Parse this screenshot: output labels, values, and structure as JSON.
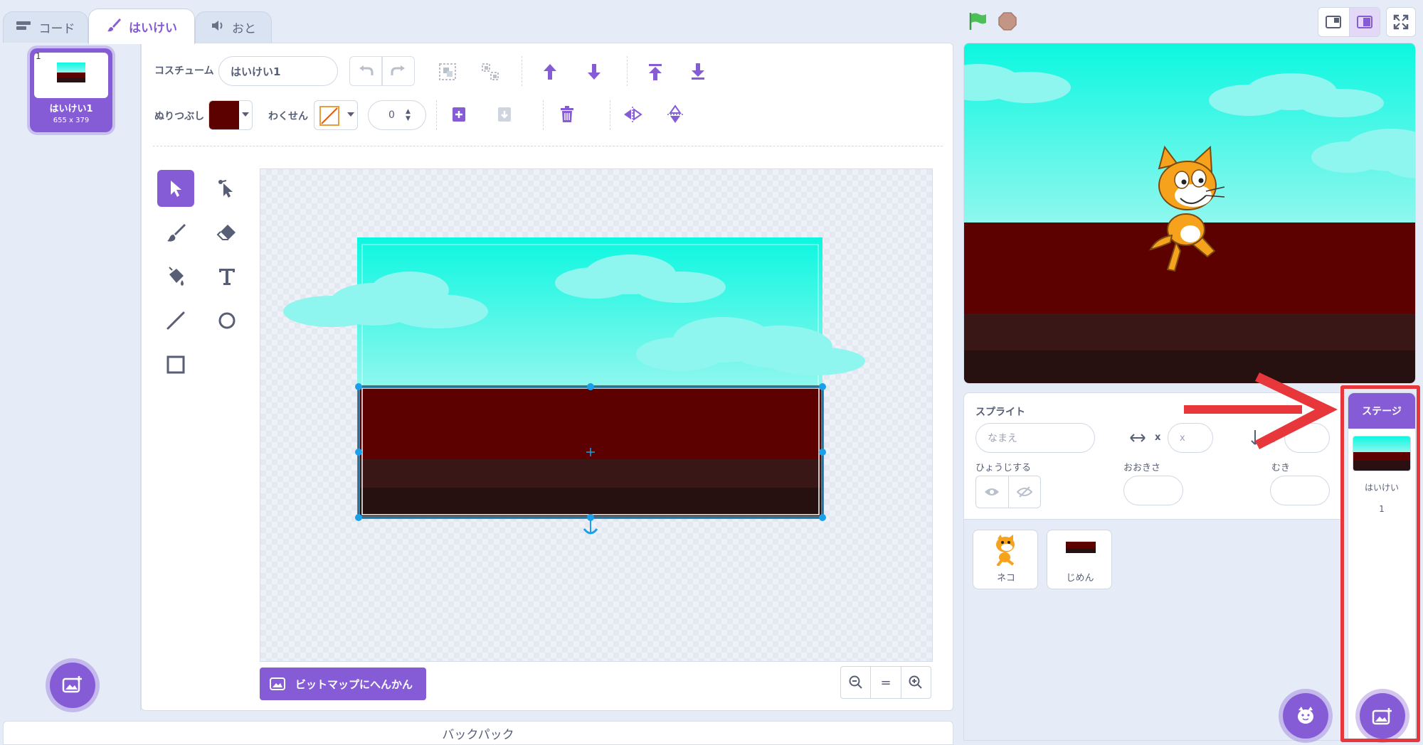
{
  "tabs": [
    {
      "label": "コード"
    },
    {
      "label": "はいけい"
    },
    {
      "label": "おと"
    }
  ],
  "costume_list": [
    {
      "number": "1",
      "name": "はいけい1",
      "size": "655 x 379"
    }
  ],
  "editor": {
    "costume_label": "コスチューム",
    "costume_name": "はいけい1",
    "fill_label": "ぬりつぶし",
    "outline_label": "わくせん",
    "outline_width": "0",
    "fill_color": "#5c0000",
    "convert_button": "ビットマップにへんかん",
    "zoom_reset": "="
  },
  "stage_controls": {
    "flag_color": "#4cbf56",
    "stop_color": "#c39585"
  },
  "sprite_info": {
    "sprite_label": "スプライト",
    "name_placeholder": "なまえ",
    "x_label": "x",
    "x_placeholder": "x",
    "y_label": "y",
    "show_label": "ひょうじする",
    "size_label": "おおきさ",
    "direction_label": "むき"
  },
  "sprites": [
    {
      "name": "ネコ"
    },
    {
      "name": "じめん"
    }
  ],
  "stage_panel": {
    "header": "ステージ",
    "backdrop_label": "はいけい",
    "backdrop_count": "1"
  },
  "backpack": {
    "label": "バックパック"
  },
  "annotation": {
    "color": "#e8373b"
  },
  "colors": {
    "accent": "#855cd6",
    "sky_top": "#0cf7e0",
    "ground": "#5c0000"
  }
}
